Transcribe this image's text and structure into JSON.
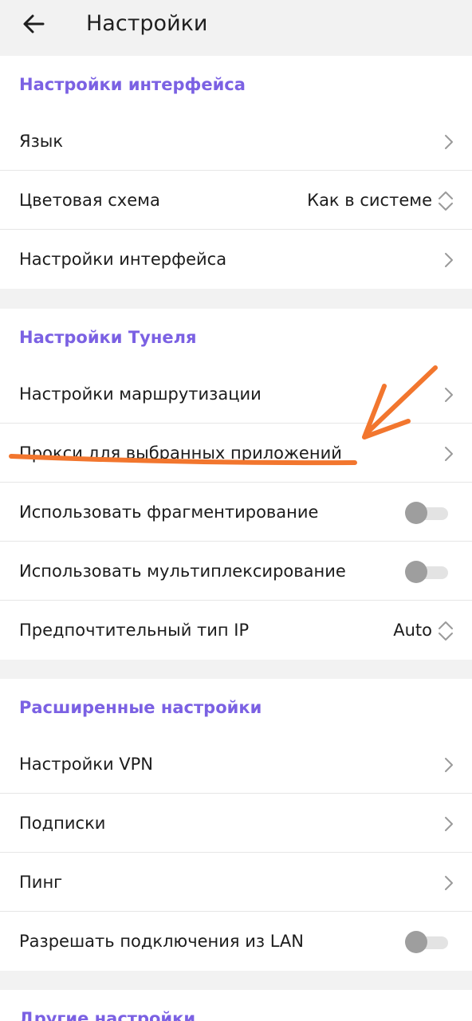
{
  "appbar": {
    "title": "Настройки"
  },
  "icons": {
    "back": "arrow-left-icon",
    "chevron": "chevron-right-icon",
    "updown": "unfold-icon"
  },
  "colors": {
    "accent": "#7b61e3",
    "annotation": "#f2762e",
    "toggle_off_knob": "#9e9e9e",
    "toggle_off_track": "#e3e3e3"
  },
  "sections": [
    {
      "header": "Настройки интерфейса",
      "rows": [
        {
          "label": "Язык",
          "type": "link"
        },
        {
          "label": "Цветовая схема",
          "type": "select",
          "value": "Как в системе"
        },
        {
          "label": "Настройки интерфейса",
          "type": "link"
        }
      ]
    },
    {
      "header": "Настройки Тунеля",
      "rows": [
        {
          "label": "Настройки маршрутизации",
          "type": "link"
        },
        {
          "label": "Прокси для выбранных приложений",
          "type": "link"
        },
        {
          "label": "Использовать фрагментирование",
          "type": "toggle",
          "checked": false
        },
        {
          "label": "Использовать мультиплексирование",
          "type": "toggle",
          "checked": false
        },
        {
          "label": "Предпочтительный тип IP",
          "type": "select",
          "value": "Auto"
        }
      ]
    },
    {
      "header": "Расширенные настройки",
      "rows": [
        {
          "label": "Настройки VPN",
          "type": "link"
        },
        {
          "label": "Подписки",
          "type": "link"
        },
        {
          "label": "Пинг",
          "type": "link"
        },
        {
          "label": "Разрешать подключения из LAN",
          "type": "toggle",
          "checked": false
        }
      ]
    },
    {
      "header": "Другие настройки",
      "rows": []
    }
  ]
}
